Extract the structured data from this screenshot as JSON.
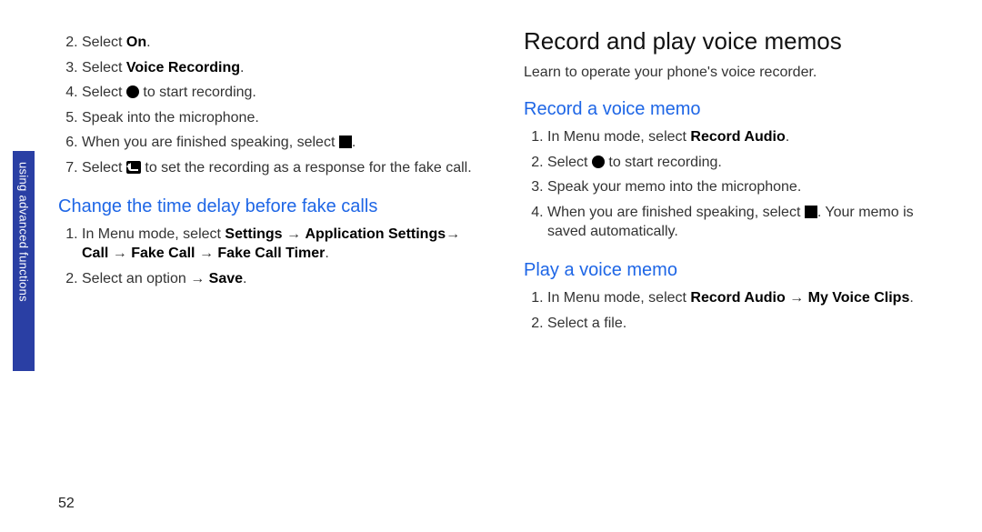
{
  "pageNumber": "52",
  "sideTab": "using advanced functions",
  "left": {
    "steps1": [
      {
        "num": "2.",
        "plain1": "Select ",
        "bold1": "On",
        "plain2": "."
      },
      {
        "num": "3.",
        "plain1": "Select ",
        "bold1": "Voice Recording",
        "plain2": "."
      },
      {
        "num": "4.",
        "plain1": "Select ",
        "icon": "circle",
        "plain2": " to start recording."
      },
      {
        "num": "5.",
        "plain1": "Speak into the microphone."
      },
      {
        "num": "6.",
        "plain1": "When you are finished speaking, select ",
        "icon": "square",
        "plain2": "."
      },
      {
        "num": "7.",
        "plain1": "Select ",
        "icon": "return",
        "plain2": " to set the recording as a response for the fake call."
      }
    ],
    "h2a": "Change the time delay before fake calls",
    "steps2": [
      {
        "num": "1.",
        "plain1": "In Menu mode, select ",
        "bold1": "Settings",
        "plain2": " → ",
        "bold2": "Application Settings",
        "plain3": "→ ",
        "bold3": "Call",
        "plain4": " → ",
        "bold4": "Fake Call",
        "plain5": " → ",
        "bold5": "Fake Call Timer",
        "plain6": "."
      },
      {
        "num": "2.",
        "plain1": "Select an option → ",
        "bold1": "Save",
        "plain2": "."
      }
    ]
  },
  "right": {
    "h1": "Record and play voice memos",
    "intro": "Learn to operate your phone's voice recorder.",
    "h2a": "Record a voice memo",
    "steps1": [
      {
        "num": "1.",
        "plain1": "In Menu mode, select ",
        "bold1": "Record Audio",
        "plain2": "."
      },
      {
        "num": "2.",
        "plain1": "Select ",
        "icon": "circle",
        "plain2": " to start recording."
      },
      {
        "num": "3.",
        "plain1": "Speak your memo into the microphone."
      },
      {
        "num": "4.",
        "plain1": "When you are finished speaking, select ",
        "icon": "square",
        "plain2": ". Your memo is saved automatically."
      }
    ],
    "h2b": "Play a voice memo",
    "steps2": [
      {
        "num": "1.",
        "plain1": "In Menu mode, select ",
        "bold1": "Record Audio",
        "plain2": " → ",
        "bold2": "My Voice Clips",
        "plain3": "."
      },
      {
        "num": "2.",
        "plain1": "Select a file."
      }
    ]
  }
}
